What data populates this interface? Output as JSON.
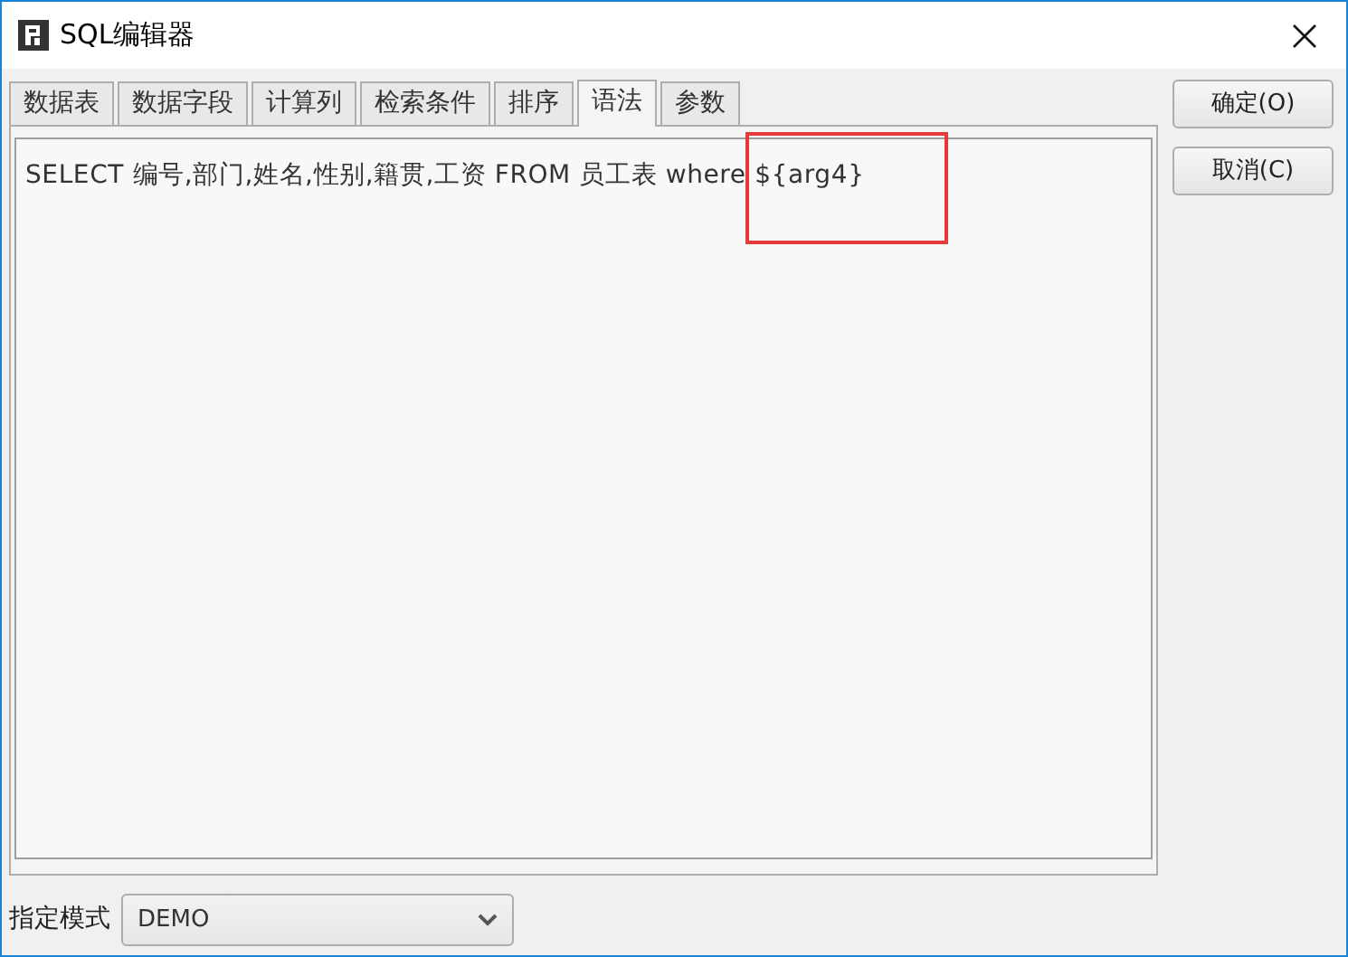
{
  "window": {
    "title": "SQL编辑器"
  },
  "tabs": [
    {
      "label": "数据表",
      "selected": false
    },
    {
      "label": "数据字段",
      "selected": false
    },
    {
      "label": "计算列",
      "selected": false
    },
    {
      "label": "检索条件",
      "selected": false
    },
    {
      "label": "排序",
      "selected": false
    },
    {
      "label": "语法",
      "selected": true
    },
    {
      "label": "参数",
      "selected": false
    }
  ],
  "sql_text": "SELECT 编号,部门,姓名,性别,籍贯,工资 FROM 员工表 where ${arg4}",
  "mode": {
    "label": "指定模式",
    "value": "DEMO"
  },
  "buttons": [
    {
      "label": "确定(O)"
    },
    {
      "label": "取消(C)"
    }
  ]
}
